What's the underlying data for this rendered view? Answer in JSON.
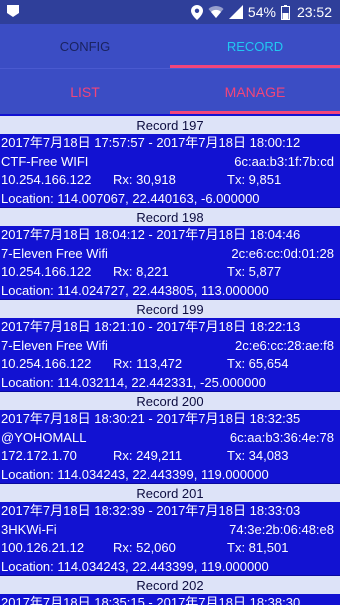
{
  "statusbar": {
    "battery_percent": "54%",
    "time": "23:52"
  },
  "tabs": {
    "config_label": "CONFIG",
    "record_label": "RECORD"
  },
  "subtabs": {
    "list_label": "LIST",
    "manage_label": "MANAGE"
  },
  "colors": {
    "statusbar": "#2f3f9a",
    "appbar": "#3b4dc4",
    "accent_pink": "#f2457a",
    "accent_cyan": "#22c8f2",
    "record_body": "#1212d2",
    "record_header": "#dde3f8"
  },
  "icons": [
    "screenshot-icon",
    "location-icon",
    "wifi-icon",
    "signal-icon",
    "battery-icon"
  ],
  "records": [
    {
      "title": "Record 197",
      "time_range": "2017年7月18日 17:57:57 - 2017年7月18日 18:00:12",
      "ssid": "CTF-Free WIFI",
      "mac": "6c:aa:b3:1f:7b:cd",
      "ip": "10.254.166.122",
      "rx": "Rx: 30,918",
      "tx": "Tx: 9,851",
      "location": "Location: 114.007067, 22.440163, -6.000000"
    },
    {
      "title": "Record 198",
      "time_range": "2017年7月18日 18:04:12 - 2017年7月18日 18:04:46",
      "ssid": "7-Eleven Free Wifi",
      "mac": "2c:e6:cc:0d:01:28",
      "ip": "10.254.166.122",
      "rx": "Rx: 8,221",
      "tx": "Tx: 5,877",
      "location": "Location: 114.024727, 22.443805, 113.000000"
    },
    {
      "title": "Record 199",
      "time_range": "2017年7月18日 18:21:10 - 2017年7月18日 18:22:13",
      "ssid": "7-Eleven Free Wifi",
      "mac": "2c:e6:cc:28:ae:f8",
      "ip": "10.254.166.122",
      "rx": "Rx: 113,472",
      "tx": "Tx: 65,654",
      "location": "Location: 114.032114, 22.442331, -25.000000"
    },
    {
      "title": "Record 200",
      "time_range": "2017年7月18日 18:30:21 - 2017年7月18日 18:32:35",
      "ssid": "@YOHOMALL",
      "mac": "6c:aa:b3:36:4e:78",
      "ip": "172.172.1.70",
      "rx": "Rx: 249,211",
      "tx": "Tx: 34,083",
      "location": "Location: 114.034243, 22.443399, 119.000000"
    },
    {
      "title": "Record 201",
      "time_range": "2017年7月18日 18:32:39 - 2017年7月18日 18:33:03",
      "ssid": "3HKWi-Fi",
      "mac": "74:3e:2b:06:48:e8",
      "ip": "100.126.21.12",
      "rx": "Rx: 52,060",
      "tx": "Tx: 81,501",
      "location": "Location: 114.034243, 22.443399, 119.000000"
    },
    {
      "title": "Record 202",
      "time_range": "2017年7月18日 18:35:15 - 2017年7月18日 18:38:30"
    }
  ]
}
